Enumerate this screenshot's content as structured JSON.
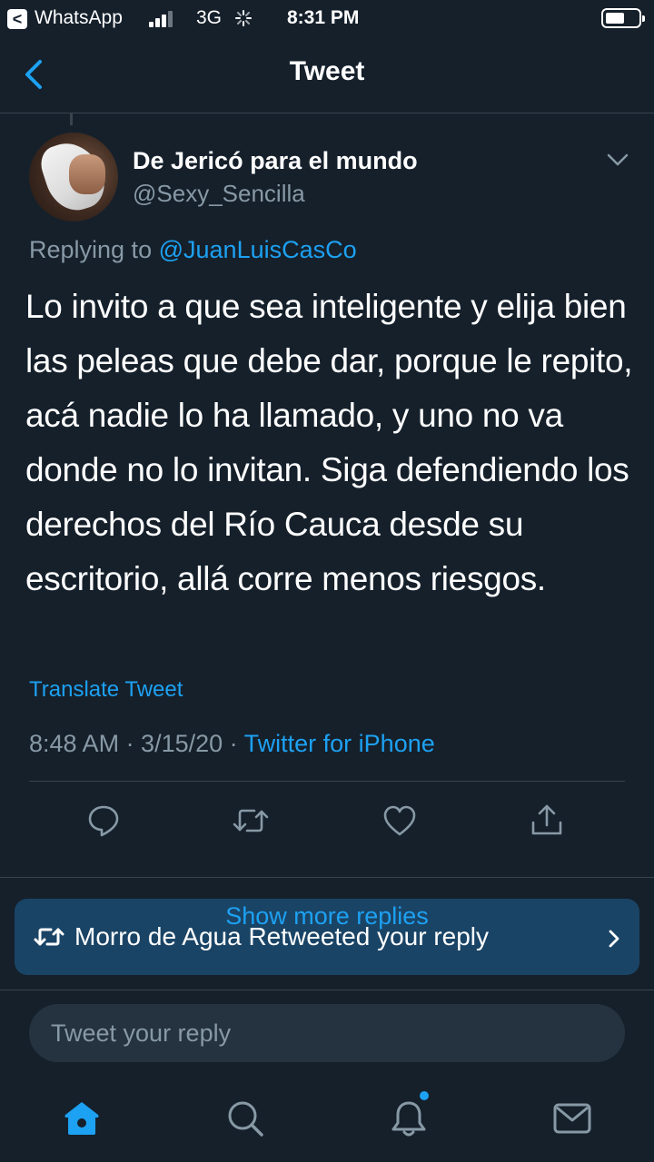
{
  "status_bar": {
    "back_app": "WhatsApp",
    "network": "3G",
    "time": "8:31 PM",
    "back_chip_glyph": "<"
  },
  "header": {
    "title": "Tweet",
    "back_icon": "chevron-left-icon"
  },
  "tweet": {
    "author_name": "De Jericó para el mundo",
    "author_handle": "@Sexy_Sencilla",
    "replying_prefix": "Replying to",
    "replying_to": "@JuanLuisCasCo",
    "text": "Lo invito a que sea inteligente y elija bien las peleas que debe dar, porque le repito, acá nadie lo ha llamado, y uno no va donde no lo invitan. Siga defendiendo los derechos del Río Cauca desde su escritorio, allá corre menos riesgos.",
    "translate_label": "Translate Tweet",
    "timestamp": "8:48 AM · 3/15/20 · ",
    "source": "Twitter for iPhone",
    "actions": [
      "reply-icon",
      "retweet-icon",
      "like-icon",
      "share-icon"
    ]
  },
  "banner": {
    "show_more": "Show more replies",
    "notification": "Morro de Agua Retweeted your reply"
  },
  "composer": {
    "placeholder": "Tweet your reply"
  },
  "tab_bar": {
    "tabs": [
      "home-icon",
      "search-icon",
      "notifications-icon",
      "messages-icon"
    ],
    "active": "home-icon"
  },
  "colors": {
    "background": "#15202b",
    "accent": "#1da1f2",
    "secondary_text": "#8899a6",
    "banner": "#1a4466",
    "divider": "#38444d"
  }
}
